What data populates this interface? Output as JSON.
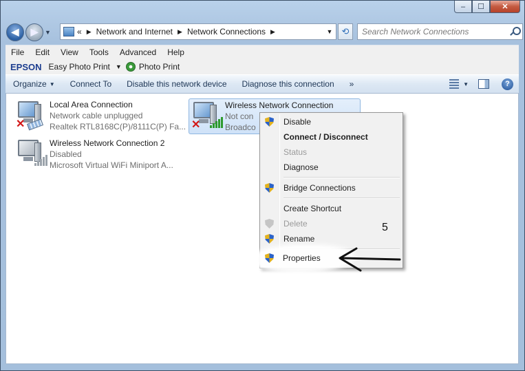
{
  "window": {
    "caption_buttons": [
      "minimize-icon",
      "maximize-icon",
      "close-icon"
    ]
  },
  "nav": {
    "breadcrumb": [
      "«",
      "Network and Internet",
      "Network Connections"
    ],
    "search_placeholder": "Search Network Connections"
  },
  "menubar": {
    "items": [
      "File",
      "Edit",
      "View",
      "Tools",
      "Advanced",
      "Help"
    ]
  },
  "epson": {
    "logo": "EPSON",
    "easy_photo_print": "Easy Photo Print",
    "photo_print": "Photo Print"
  },
  "commandbar": {
    "organize": "Organize",
    "connect_to": "Connect To",
    "disable": "Disable this network device",
    "diagnose": "Diagnose this connection",
    "more": "»"
  },
  "connections": [
    {
      "name": "Local Area Connection",
      "status": "Network cable unplugged",
      "device": "Realtek RTL8168C(P)/8111C(P) Fa..."
    },
    {
      "name": "Wireless Network Connection",
      "status": "Not con",
      "device": "Broadco"
    },
    {
      "name": "Wireless Network Connection 2",
      "status": "Disabled",
      "device": "Microsoft Virtual WiFi Miniport A..."
    }
  ],
  "context_menu": {
    "disable": "Disable",
    "connect": "Connect / Disconnect",
    "status": "Status",
    "diagnose": "Diagnose",
    "bridge": "Bridge Connections",
    "shortcut": "Create Shortcut",
    "delete": "Delete",
    "rename": "Rename",
    "properties": "Properties"
  },
  "annotation": {
    "number": "5"
  }
}
